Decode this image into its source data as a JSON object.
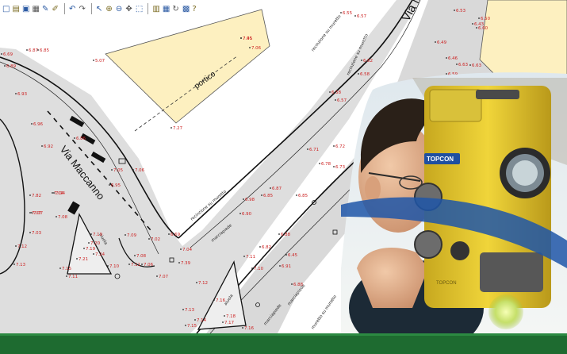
{
  "toolbar": {
    "icons": [
      "new-icon",
      "open-icon",
      "save-icon",
      "print-icon",
      "pencil-icon",
      "brush-icon",
      "undo-icon",
      "redo-icon",
      "select-icon",
      "zoom-in-icon",
      "zoom-out-icon",
      "pan-icon",
      "zoom-window-icon",
      "layers-icon",
      "grid-icon",
      "refresh-icon",
      "palette-icon",
      "help-icon"
    ]
  },
  "map": {
    "streets": [
      {
        "id": "via-maccanno",
        "label": "Via Maccanno"
      },
      {
        "id": "via-top",
        "label": "Via M"
      }
    ],
    "building_label": "portico",
    "annotations": [
      {
        "id": "recinzione-top",
        "label": "recinzione su muretto"
      },
      {
        "id": "recinzione-right",
        "label": "recinzione su muretto"
      },
      {
        "id": "recinzione-mid",
        "label": "recinzione su muretto"
      },
      {
        "id": "marciapiede-1",
        "label": "marciapiede"
      },
      {
        "id": "marciapiede-2",
        "label": "marciapiede"
      },
      {
        "id": "marciapiede-3",
        "label": "marciapiede"
      },
      {
        "id": "aiuola-1",
        "label": "aiuola"
      },
      {
        "id": "aiuola-2",
        "label": "aiuola"
      },
      {
        "id": "muro-bottom",
        "label": "muretto su muretto"
      }
    ],
    "elevations": [
      "7.41",
      "7.06",
      "5.07",
      "7.27",
      "6.69",
      "6.87",
      "6.85",
      "6.93",
      "6.96",
      "6.92",
      "6.86",
      "6.89",
      "7.06",
      "7.05",
      "6.95",
      "7.04",
      "7.08",
      "7.07",
      "7.04",
      "7.03",
      "7.13",
      "7.12",
      "7.82",
      "7.07",
      "7.19",
      "7.20",
      "7.19",
      "7.21",
      "7.24",
      "7.15",
      "7.11",
      "7.10",
      "7.09",
      "7.08",
      "7.11",
      "7.06",
      "7.07",
      "7.11",
      "7.10",
      "7.39",
      "7.12",
      "7.13",
      "7.14",
      "7.16",
      "7.18",
      "7.17",
      "7.15",
      "7.16",
      "6.55",
      "6.57",
      "6.62",
      "6.58",
      "6.58",
      "6.57",
      "6.71",
      "6.72",
      "6.78",
      "6.73",
      "6.87",
      "6.85",
      "6.98",
      "6.90",
      "6.85",
      "6.88",
      "6.82",
      "6.91",
      "6.88",
      "6.45",
      "6.49",
      "6.46",
      "6.63",
      "6.63",
      "6.59",
      "6.62",
      "6.61",
      "6.53",
      "6.50",
      "6.43",
      "6.60",
      "6.69",
      "7.02",
      "7.04",
      "7.05"
    ]
  },
  "photo": {
    "brand": "TOPCON",
    "model": "TOPCON"
  },
  "footer": {
    "color": "#1e6b30"
  },
  "colors": {
    "building": "#fdf0c0",
    "road": "#dcdcdc",
    "elevation_text": "#cc1f1f",
    "instrument": "#e8c92a"
  }
}
